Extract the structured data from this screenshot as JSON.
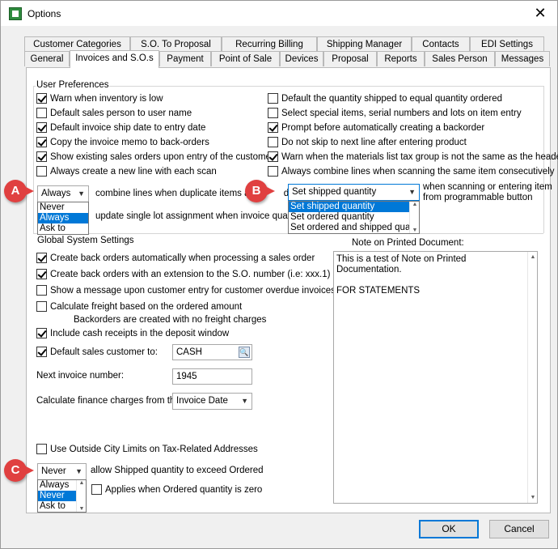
{
  "window": {
    "title": "Options"
  },
  "tabs_row1": [
    "Customer Categories",
    "S.O. To Proposal",
    "Recurring Billing",
    "Shipping Manager",
    "Contacts",
    "EDI Settings"
  ],
  "tabs_row2": [
    "General",
    "Invoices and S.O.s",
    "Payment",
    "Point of Sale",
    "Devices",
    "Proposal",
    "Reports",
    "Sales Person",
    "Messages"
  ],
  "active_tab": "Invoices and S.O.s",
  "user_prefs": {
    "label": "User Preferences",
    "left": [
      {
        "label": "Warn when inventory is low",
        "checked": true
      },
      {
        "label": "Default sales person to user name",
        "checked": false
      },
      {
        "label": "Default invoice ship date to entry date",
        "checked": true
      },
      {
        "label": "Copy the invoice memo to back-orders",
        "checked": true
      },
      {
        "label": "Show existing sales orders upon entry of the customer",
        "checked": true
      },
      {
        "label": "Always create a new line with each scan",
        "checked": false
      }
    ],
    "right": [
      {
        "label": "Default the quantity shipped to equal quantity ordered",
        "checked": false
      },
      {
        "label": "Select special items, serial numbers and lots on item entry",
        "checked": false
      },
      {
        "label": "Prompt before automatically creating a backorder",
        "checked": true
      },
      {
        "label": "Do not skip to next line after entering product",
        "checked": false
      },
      {
        "label": "Warn when the materials list tax group is not the same as the header",
        "checked": true
      },
      {
        "label": "Always combine lines when scanning the same item consecutively",
        "checked": false
      }
    ],
    "combine_combo": {
      "value": "Always",
      "options": [
        "Never",
        "Always",
        "Ask to"
      ],
      "selected": "Always"
    },
    "combine_label": "combine lines when duplicate items are",
    "combine_label_tail": "d:",
    "shipped_combo": {
      "value": "Set shipped quantity",
      "options": [
        "Set shipped quantity",
        "Set ordered quantity",
        "Set ordered and shipped quar"
      ],
      "selected": "Set shipped quantity"
    },
    "scanning_label_1": "when scanning or entering item",
    "scanning_label_2": "from programmable button",
    "single_lot_label": "update single lot assignment when invoice quantity"
  },
  "global": {
    "label": "Global System Settings",
    "items": [
      {
        "label": "Create back orders automatically when processing a sales order",
        "checked": true
      },
      {
        "label": "Create back orders with an extension to the S.O. number (i.e: xxx.1)",
        "checked": true
      },
      {
        "label": "Show a message upon customer entry for customer overdue invoices",
        "checked": false
      },
      {
        "label": "Calculate freight based on the ordered amount",
        "checked": false
      },
      {
        "label": "Include cash receipts in the deposit window",
        "checked": true
      },
      {
        "label": "Default sales customer to:",
        "checked": true
      }
    ],
    "freight_note": "Backorders are created with no freight charges",
    "default_customer": "CASH",
    "next_invoice_label": "Next invoice number:",
    "next_invoice_value": "1945",
    "finance_label": "Calculate finance charges from the",
    "finance_value": "Invoice Date",
    "outside_city": {
      "label": "Use Outside City Limits on Tax-Related Addresses",
      "checked": false
    },
    "exceed_combo": {
      "value": "Never",
      "options": [
        "Always",
        "Never",
        "Ask to"
      ],
      "selected": "Never"
    },
    "exceed_label": "allow Shipped quantity to exceed Ordered",
    "zero_label": "Applies when Ordered quantity is zero",
    "zero_checked": false
  },
  "note": {
    "label": "Note on Printed Document:",
    "text": "This is a test of Note on Printed\nDocumentation.\n\nFOR STATEMENTS"
  },
  "buttons": {
    "ok": "OK",
    "cancel": "Cancel"
  },
  "badges": [
    "A",
    "B",
    "C"
  ],
  "colors": {
    "accent": "#0078d7",
    "badge": "#e04040"
  }
}
